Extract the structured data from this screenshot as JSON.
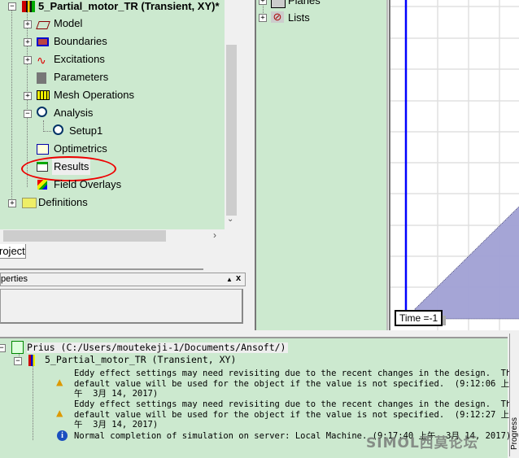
{
  "project_tree": {
    "design": "5_Partial_motor_TR (Transient, XY)*",
    "items": [
      {
        "label": "Model",
        "icon": "model-icon"
      },
      {
        "label": "Boundaries",
        "icon": "boundaries-icon"
      },
      {
        "label": "Excitations",
        "icon": "excitations-icon"
      },
      {
        "label": "Parameters",
        "icon": "parameters-icon"
      },
      {
        "label": "Mesh Operations",
        "icon": "mesh-icon"
      },
      {
        "label": "Analysis",
        "icon": "analysis-icon"
      },
      {
        "label": "Setup1",
        "icon": "setup-icon"
      },
      {
        "label": "Optimetrics",
        "icon": "optimetrics-icon"
      },
      {
        "label": "Results",
        "icon": "results-icon",
        "highlighted": true
      },
      {
        "label": "Field Overlays",
        "icon": "field-overlays-icon"
      },
      {
        "label": "Definitions",
        "icon": "folder-icon"
      }
    ]
  },
  "tab_label": "roject",
  "properties": {
    "title": "perties",
    "pin": "▲",
    "close": "x"
  },
  "model_tree": {
    "items": [
      {
        "label": "Planes"
      },
      {
        "label": "Lists"
      }
    ]
  },
  "viewport": {
    "time_label": "Time =-1",
    "shape_color": "#a0a0d4",
    "axis_color": "#0000ff"
  },
  "messages": {
    "project": "Prius (C:/Users/moutekeji-1/Documents/Ansoft/)",
    "design": "5_Partial_motor_TR (Transient, XY)",
    "entries": [
      {
        "type": "warning",
        "lines": [
          "Eddy effect settings may need revisiting due to the recent changes in the design.  The",
          "default value will be used for the object if the value is not specified.  (9:12:06 上",
          "午  3月 14, 2017)"
        ]
      },
      {
        "type": "warning",
        "lines": [
          "Eddy effect settings may need revisiting due to the recent changes in the design.  The",
          "default value will be used for the object if the value is not specified.  (9:12:27 上",
          "午  3月 14, 2017)"
        ]
      },
      {
        "type": "info",
        "lines": [
          "Normal completion of simulation on server: Local Machine. (9:17:40 上午  3月 14, 2017)"
        ]
      }
    ]
  },
  "side_panel": {
    "label": "Progress"
  },
  "watermark": "SIMOL西莫论坛"
}
